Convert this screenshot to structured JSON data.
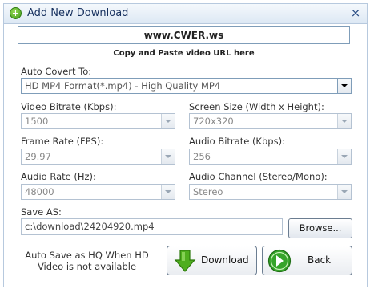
{
  "window": {
    "title": "Add New Download",
    "close_icon": "×"
  },
  "url": {
    "value": "www.CWER.ws",
    "hint": "Copy and Paste video URL here"
  },
  "convert": {
    "label": "Auto Covert To:",
    "value": "HD MP4 Format(*.mp4) - High Quality MP4"
  },
  "video_bitrate": {
    "label": "Video Bitrate (Kbps):",
    "value": "1500"
  },
  "screen_size": {
    "label": "Screen Size (Width x Height):",
    "value": "720x320"
  },
  "frame_rate": {
    "label": "Frame Rate (FPS):",
    "value": "29.97"
  },
  "audio_bitrate": {
    "label": "Audio Bitrate (Kbps):",
    "value": "256"
  },
  "audio_rate": {
    "label": "Audio Rate (Hz):",
    "value": "48000"
  },
  "audio_channel": {
    "label": "Audio Channel (Stereo/Mono):",
    "value": "Stereo"
  },
  "save": {
    "label": "Save AS:",
    "path": "c:\\download\\24204920.mp4",
    "browse_label": "Browse..."
  },
  "note": {
    "line1": "Auto Save as HQ When HD",
    "line2": "Video is not available"
  },
  "buttons": {
    "download_label": "Download",
    "back_label": "Back"
  },
  "colors": {
    "title_text": "#16305e",
    "download_icon": "#4fae1e",
    "back_icon": "#36a42a"
  }
}
